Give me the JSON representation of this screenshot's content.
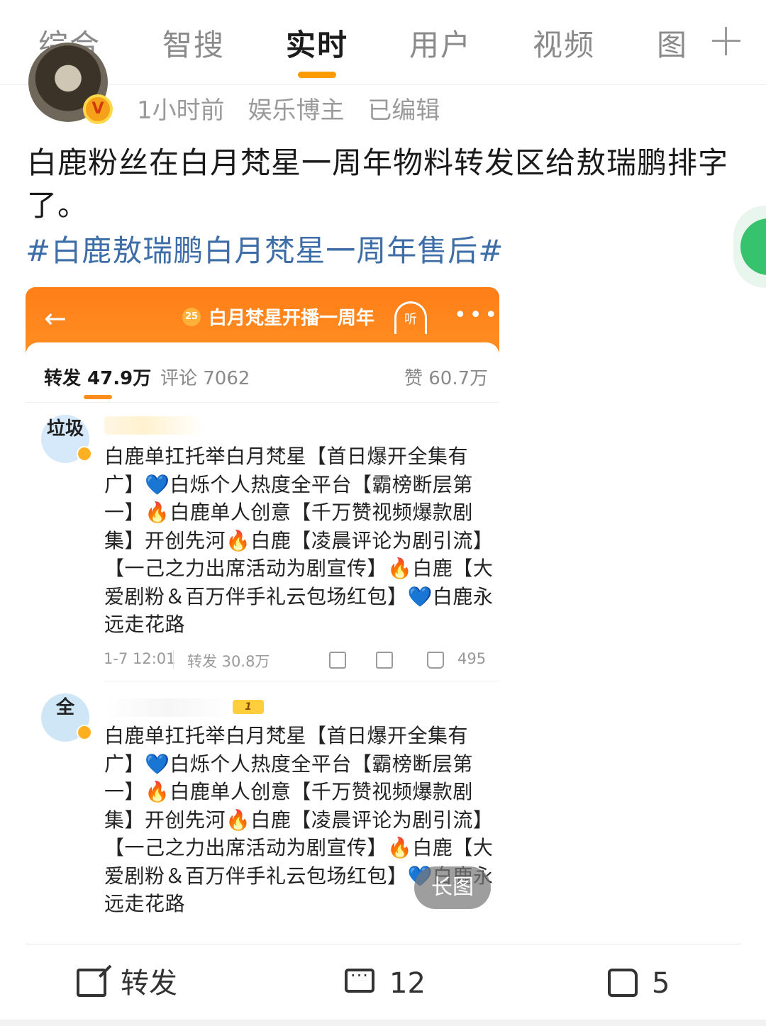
{
  "tabs": [
    {
      "label": "综合",
      "active": false
    },
    {
      "label": "智搜",
      "active": false
    },
    {
      "label": "实时",
      "active": true
    },
    {
      "label": "用户",
      "active": false
    },
    {
      "label": "视频",
      "active": false
    },
    {
      "label": "图",
      "active": false
    }
  ],
  "accent_color": "#ff9a00",
  "hashtag_color": "#3d6ea8",
  "post": {
    "verified_badge": "V",
    "time": "1小时前",
    "author_tag": "娱乐博主",
    "edited": "已编辑",
    "text": "白鹿粉丝在白月梵星一周年物料转发区给敖瑞鹏排字了。",
    "hashtag": "#白鹿敖瑞鹏白月梵星一周年售后#"
  },
  "screenshot": {
    "header_title": "白月梵星开播一周年",
    "listen_label": "听",
    "stats": {
      "reposts": "转发 47.9万",
      "comments": "评论 7062",
      "likes": "赞 60.7万"
    },
    "comments": [
      {
        "avatar_text": "垃圾",
        "text": "白鹿单扛托举白月梵星【首日爆开全集有广】💙白烁个人热度全平台【霸榜断层第一】🔥白鹿单人创意【千万赞视频爆款剧集】开创先河🔥白鹿【凌晨评论为剧引流】【一己之力出席活动为剧宣传】🔥白鹿【大爱剧粉＆百万伴手礼云包场红包】💙白鹿永远走花路",
        "date": "1-7 12:01",
        "reposts": "转发 30.8万",
        "likes": "495"
      },
      {
        "avatar_text": "全",
        "level_badge": "1",
        "text": "白鹿单扛托举白月梵星【首日爆开全集有广】💙白烁个人热度全平台【霸榜断层第一】🔥白鹿单人创意【千万赞视频爆款剧集】开创先河🔥白鹿【凌晨评论为剧引流】【一己之力出席活动为剧宣传】🔥白鹿【大爱剧粉＆百万伴手礼云包场红包】💙白鹿永远走花路"
      }
    ],
    "long_image_label": "长图"
  },
  "actions": {
    "share_label": "转发",
    "comment_count": "12",
    "like_count": "5"
  }
}
